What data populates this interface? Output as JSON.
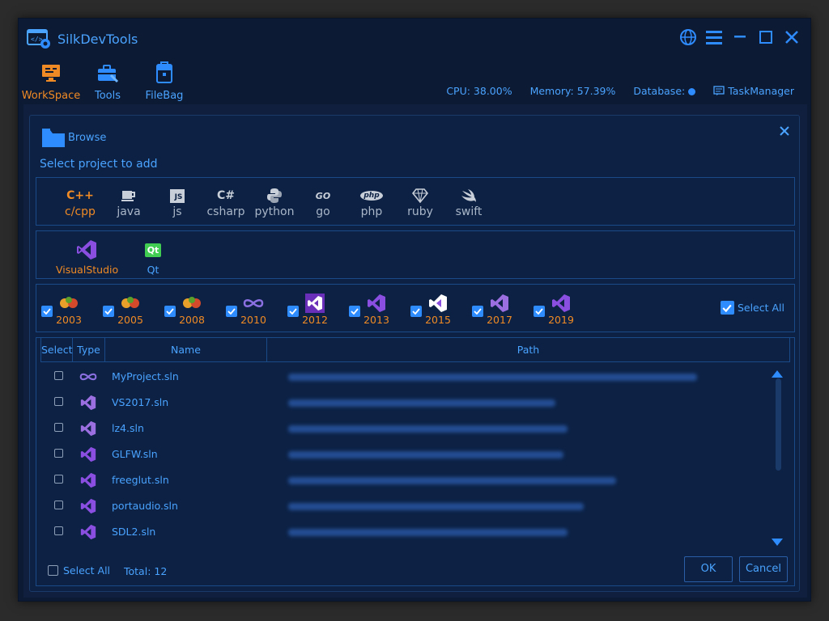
{
  "app": {
    "title": "SilkDevTools"
  },
  "nav": [
    {
      "label": "WorkSpace",
      "icon": "monitor-icon"
    },
    {
      "label": "Tools",
      "icon": "toolbox-icon"
    },
    {
      "label": "FileBag",
      "icon": "bag-icon"
    }
  ],
  "status": {
    "cpu": "CPU: 38.00%",
    "memory": "Memory: 57.39%",
    "database": "Database:",
    "task_manager": "TaskManager"
  },
  "dialog": {
    "browse": "Browse",
    "subtitle": "Select project to add",
    "languages": [
      {
        "label": "c/cpp",
        "icon": "C++"
      },
      {
        "label": "java",
        "icon": "coffee"
      },
      {
        "label": "js",
        "icon": "JS"
      },
      {
        "label": "csharp",
        "icon": "C#"
      },
      {
        "label": "python",
        "icon": "python"
      },
      {
        "label": "go",
        "icon": "GO"
      },
      {
        "label": "php",
        "icon": "php"
      },
      {
        "label": "ruby",
        "icon": "gem"
      },
      {
        "label": "swift",
        "icon": "swift"
      }
    ],
    "ides": [
      {
        "label": "VisualStudio",
        "icon": "visualstudio-icon"
      },
      {
        "label": "Qt",
        "icon": "Qt"
      }
    ],
    "versions": [
      "2003",
      "2005",
      "2008",
      "2010",
      "2012",
      "2013",
      "2015",
      "2017",
      "2019"
    ],
    "select_all_versions": "Select All",
    "table": {
      "headers": {
        "select": "Select",
        "type": "Type",
        "name": "Name",
        "path": "Path"
      },
      "rows": [
        {
          "name": "MyProject.sln",
          "icon": "vs2010-icon"
        },
        {
          "name": "VS2017.sln",
          "icon": "vs2017-icon"
        },
        {
          "name": "lz4.sln",
          "icon": "vs2017-icon"
        },
        {
          "name": "GLFW.sln",
          "icon": "vs2019-icon"
        },
        {
          "name": "freeglut.sln",
          "icon": "vs2019-icon"
        },
        {
          "name": "portaudio.sln",
          "icon": "vs2019-icon"
        },
        {
          "name": "SDL2.sln",
          "icon": "vs2019-icon"
        }
      ]
    },
    "footer": {
      "select_all": "Select All",
      "total": "Total: 12",
      "ok": "OK",
      "cancel": "Cancel"
    }
  },
  "colors": {
    "accent": "#4aa3ff",
    "active": "#f08a24",
    "check": "#2f8cff",
    "background": "#0c2144"
  }
}
